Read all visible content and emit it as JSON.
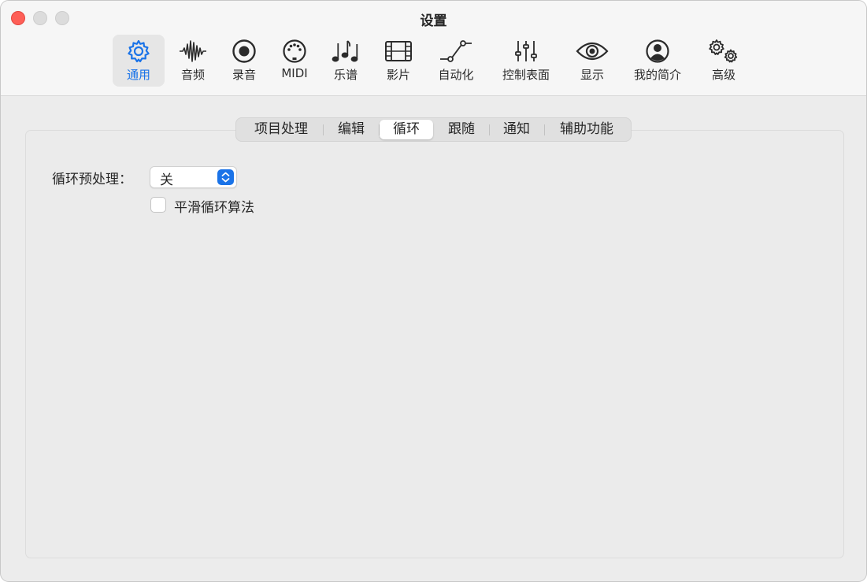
{
  "window": {
    "title": "设置"
  },
  "toolbar": {
    "items": [
      {
        "label": "通用",
        "icon": "gear-icon",
        "selected": true
      },
      {
        "label": "音频",
        "icon": "waveform-icon"
      },
      {
        "label": "录音",
        "icon": "record-icon"
      },
      {
        "label": "MIDI",
        "icon": "midi-port-icon"
      },
      {
        "label": "乐谱",
        "icon": "music-notes-icon"
      },
      {
        "label": "影片",
        "icon": "film-icon"
      },
      {
        "label": "自动化",
        "icon": "automation-curve-icon"
      },
      {
        "label": "控制表面",
        "icon": "sliders-icon"
      },
      {
        "label": "显示",
        "icon": "eye-icon"
      },
      {
        "label": "我的简介",
        "icon": "profile-icon"
      },
      {
        "label": "高级",
        "icon": "gears-icon"
      }
    ]
  },
  "tabs": [
    {
      "label": "项目处理"
    },
    {
      "label": "编辑"
    },
    {
      "label": "循环",
      "active": true
    },
    {
      "label": "跟随"
    },
    {
      "label": "通知"
    },
    {
      "label": "辅助功能"
    }
  ],
  "settings": {
    "loop_preprocess_label": "循环预处理：",
    "loop_preprocess_value": "关",
    "smooth_loop_label": "平滑循环算法",
    "smooth_loop_checked": false
  },
  "colors": {
    "accent": "#1a73e8",
    "close_button": "#fe5f57"
  }
}
